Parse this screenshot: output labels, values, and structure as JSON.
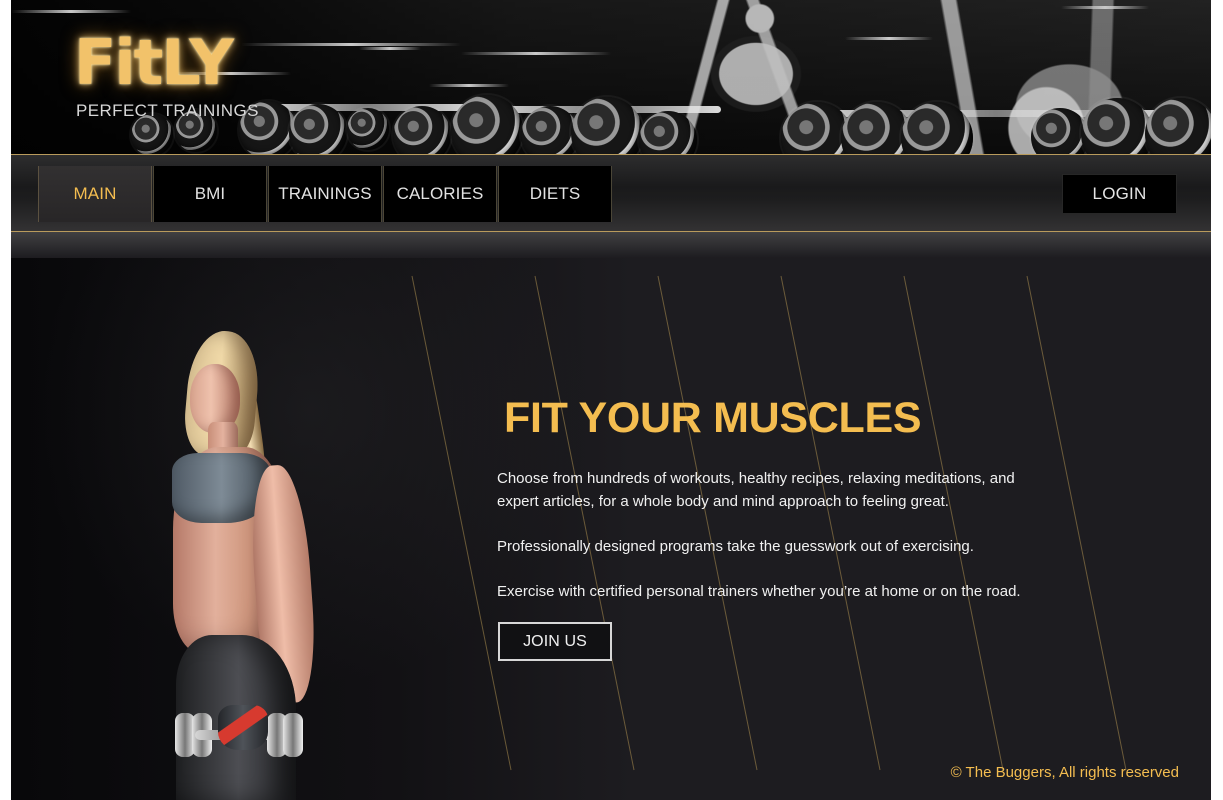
{
  "brand": {
    "logo_text": "FitLY",
    "tagline": "PERFECT TRAININGS"
  },
  "navigation": {
    "tabs": [
      {
        "label": "MAIN",
        "active": true
      },
      {
        "label": "BMI",
        "active": false
      },
      {
        "label": "TRAININGS",
        "active": false
      },
      {
        "label": "CALORIES",
        "active": false
      },
      {
        "label": "DIETS",
        "active": false
      }
    ],
    "login_label": "LOGIN"
  },
  "hero": {
    "headline": "FIT YOUR MUSCLES",
    "paragraphs": [
      "Choose from hundreds of workouts, healthy recipes, relaxing meditations, and expert articles, for a whole body and mind approach to feeling great.",
      "Professionally designed programs take the guesswork out of exercising.",
      "Exercise with certified personal trainers whether you’re at home or on the road."
    ],
    "cta_label": "JOIN US"
  },
  "footer": {
    "copyright": "© The Buggers, All rights reserved"
  },
  "icons": {
    "decorative": [
      "dumbbell-rack-image",
      "fitness-woman-image"
    ]
  },
  "colors": {
    "accent_gold": "#f4bd50",
    "background_dark": "#1d1c20",
    "button_black": "#000000",
    "text_light": "#f1f1f1"
  }
}
